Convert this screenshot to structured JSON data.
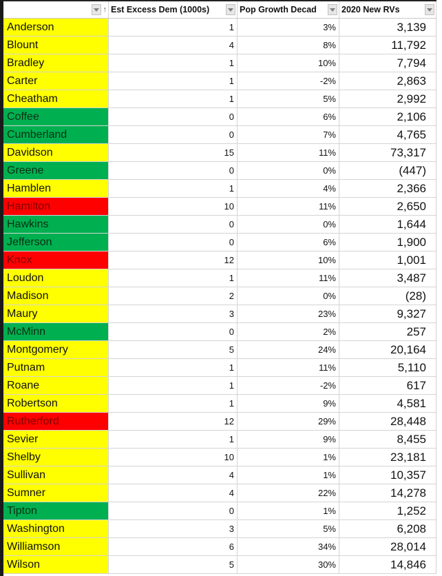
{
  "header": {
    "col0": "",
    "col1": "Est Excess Dem (1000s)",
    "col2": "Pop Growth Decad",
    "col3": "2020 New RVs"
  },
  "colors": {
    "yellow": "#ffff00",
    "green": "#00b050",
    "red": "#ff0000"
  },
  "rows": [
    {
      "county": "Anderson",
      "color": "yellow",
      "dem": "1",
      "growth": "3%",
      "rvs": "3,139"
    },
    {
      "county": "Blount",
      "color": "yellow",
      "dem": "4",
      "growth": "8%",
      "rvs": "11,792"
    },
    {
      "county": "Bradley",
      "color": "yellow",
      "dem": "1",
      "growth": "10%",
      "rvs": "7,794"
    },
    {
      "county": "Carter",
      "color": "yellow",
      "dem": "1",
      "growth": "-2%",
      "rvs": "2,863"
    },
    {
      "county": "Cheatham",
      "color": "yellow",
      "dem": "1",
      "growth": "5%",
      "rvs": "2,992"
    },
    {
      "county": "Coffee",
      "color": "green",
      "dem": "0",
      "growth": "6%",
      "rvs": "2,106"
    },
    {
      "county": "Cumberland",
      "color": "green",
      "dem": "0",
      "growth": "7%",
      "rvs": "4,765"
    },
    {
      "county": "Davidson",
      "color": "yellow",
      "dem": "15",
      "growth": "11%",
      "rvs": "73,317"
    },
    {
      "county": "Greene",
      "color": "green",
      "dem": "0",
      "growth": "0%",
      "rvs": "(447)"
    },
    {
      "county": "Hamblen",
      "color": "yellow",
      "dem": "1",
      "growth": "4%",
      "rvs": "2,366"
    },
    {
      "county": "Hamilton",
      "color": "red",
      "dem": "10",
      "growth": "11%",
      "rvs": "2,650"
    },
    {
      "county": "Hawkins",
      "color": "green",
      "dem": "0",
      "growth": "0%",
      "rvs": "1,644"
    },
    {
      "county": "Jefferson",
      "color": "green",
      "dem": "0",
      "growth": "6%",
      "rvs": "1,900"
    },
    {
      "county": "Knox",
      "color": "red",
      "dem": "12",
      "growth": "10%",
      "rvs": "1,001"
    },
    {
      "county": "Loudon",
      "color": "yellow",
      "dem": "1",
      "growth": "11%",
      "rvs": "3,487"
    },
    {
      "county": "Madison",
      "color": "yellow",
      "dem": "2",
      "growth": "0%",
      "rvs": "(28)"
    },
    {
      "county": "Maury",
      "color": "yellow",
      "dem": "3",
      "growth": "23%",
      "rvs": "9,327"
    },
    {
      "county": "McMinn",
      "color": "green",
      "dem": "0",
      "growth": "2%",
      "rvs": "257"
    },
    {
      "county": "Montgomery",
      "color": "yellow",
      "dem": "5",
      "growth": "24%",
      "rvs": "20,164"
    },
    {
      "county": "Putnam",
      "color": "yellow",
      "dem": "1",
      "growth": "11%",
      "rvs": "5,110"
    },
    {
      "county": "Roane",
      "color": "yellow",
      "dem": "1",
      "growth": "-2%",
      "rvs": "617"
    },
    {
      "county": "Robertson",
      "color": "yellow",
      "dem": "1",
      "growth": "9%",
      "rvs": "4,581"
    },
    {
      "county": "Rutherford",
      "color": "red",
      "dem": "12",
      "growth": "29%",
      "rvs": "28,448"
    },
    {
      "county": "Sevier",
      "color": "yellow",
      "dem": "1",
      "growth": "9%",
      "rvs": "8,455"
    },
    {
      "county": "Shelby",
      "color": "yellow",
      "dem": "10",
      "growth": "1%",
      "rvs": "23,181"
    },
    {
      "county": "Sullivan",
      "color": "yellow",
      "dem": "4",
      "growth": "1%",
      "rvs": "10,357"
    },
    {
      "county": "Sumner",
      "color": "yellow",
      "dem": "4",
      "growth": "22%",
      "rvs": "14,278"
    },
    {
      "county": "Tipton",
      "color": "green",
      "dem": "0",
      "growth": "1%",
      "rvs": "1,252"
    },
    {
      "county": "Washington",
      "color": "yellow",
      "dem": "3",
      "growth": "5%",
      "rvs": "6,208"
    },
    {
      "county": "Williamson",
      "color": "yellow",
      "dem": "6",
      "growth": "34%",
      "rvs": "28,014"
    },
    {
      "county": "Wilson",
      "color": "yellow",
      "dem": "5",
      "growth": "30%",
      "rvs": "14,846"
    }
  ]
}
